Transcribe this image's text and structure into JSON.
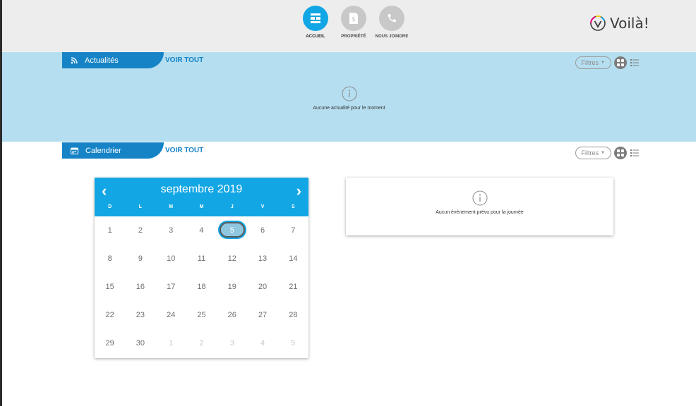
{
  "nav": {
    "items": [
      {
        "label": "ACCUEIL",
        "icon": "home-grid-icon",
        "active": true
      },
      {
        "label": "PROPRIÉTÉ",
        "icon": "document-dollar-icon",
        "active": false
      },
      {
        "label": "NOUS JOINDRE",
        "icon": "phone-icon",
        "active": false
      }
    ]
  },
  "brand": {
    "name": "Voilà!",
    "icon": "v-check-logo-icon"
  },
  "news": {
    "title": "Actualités",
    "voir_tout": "VOIR TOUT",
    "filters_label": "Filtres",
    "empty_message": "Aucune actualité pour le moment"
  },
  "calendar_section": {
    "title": "Calendrier",
    "voir_tout": "VOIR TOUT",
    "filters_label": "Filtres"
  },
  "calendar": {
    "month_label": "septembre 2019",
    "weekdays": [
      "D",
      "L",
      "M",
      "M",
      "J",
      "V",
      "S"
    ],
    "weeks": [
      [
        "1",
        "2",
        "3",
        "4",
        "5",
        "6",
        "7"
      ],
      [
        "8",
        "9",
        "10",
        "11",
        "12",
        "13",
        "14"
      ],
      [
        "15",
        "16",
        "17",
        "18",
        "19",
        "20",
        "21"
      ],
      [
        "22",
        "23",
        "24",
        "25",
        "26",
        "27",
        "28"
      ],
      [
        "29",
        "30",
        "1",
        "2",
        "3",
        "4",
        "5"
      ]
    ],
    "selected_day": "5"
  },
  "events": {
    "empty_message": "Aucun événement prévu pour la journée"
  },
  "colors": {
    "accent": "#12a6e4",
    "primary": "#1583c6",
    "news_bg": "#b5dff0"
  }
}
